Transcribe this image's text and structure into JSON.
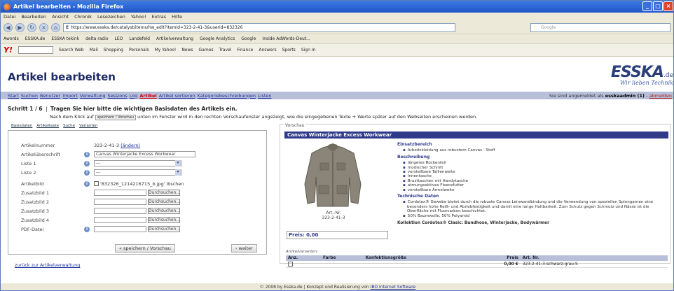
{
  "browser": {
    "title": "Artikel bearbeiten - Mozilla Firefox",
    "menu": [
      "Datei",
      "Bearbeiten",
      "Ansicht",
      "Chronik",
      "Lesezeichen",
      "Yahoo!",
      "Extras",
      "Hilfe"
    ],
    "url": "https://www.esska.de/catalyst/items/hw_edit?itemid=323-2-41-3&userid=832326",
    "search_placeholder": "Google",
    "bookmarks": [
      "Awords",
      "ESSKA.de",
      "ESSKA tekink",
      "delta radio",
      "LEO",
      "Landefeld",
      "Artikelverwaltung",
      "Google Analytics",
      "Google",
      "Inside AdWords-Deut..."
    ],
    "yahoo_items": [
      "Search Web",
      "Mail",
      "Shopping",
      "Personals",
      "My Yahoo!",
      "News",
      "Games",
      "Travel",
      "Finance",
      "Answers",
      "Sports",
      "Sign In"
    ]
  },
  "page": {
    "title": "Artikel bearbeiten",
    "brand": "ESSKA",
    "brand_suffix": ".de",
    "tagline": "Wir lieben Technik"
  },
  "nav": {
    "items": [
      "Start",
      "Suchen",
      "Benutzer",
      "Import",
      "Verwaltung",
      "Sessions",
      "Log",
      "Artikel",
      "Artikel sortieren",
      "Kategoriebeschreibungen",
      "Listen"
    ],
    "active": "Artikel",
    "user_prefix": "Sie sind angemeldet als",
    "user": "esskaadmin (1)",
    "logout": "abmelden"
  },
  "step": {
    "label": "Schritt 1 / 6",
    "headline": "Tragen Sie hier bitte die wichtigen Basisdaten des Artikels ein.",
    "line2_pre": "Nach dem Klick auf",
    "line2_btn": "speichern / Vorschau",
    "line2_post": "unten im Fenster wird in den rechten Vorschaufenster angezeigt, wie die eingegebenen Texte + Werte später auf den Webseiten erscheinen werden."
  },
  "tabs": [
    "Basisdaten",
    "Artikeltexte",
    "Suche",
    "Varianten"
  ],
  "form": {
    "artikelnummer_label": "Artikelnummer",
    "artikelnummer": "323-2-41-3",
    "aendern": "(ändern)",
    "ueberschrift_label": "Artikelüberschrift",
    "ueberschrift": "Canvas Winterjacke Excess Workwear",
    "liste1_label": "Liste 1",
    "liste2_label": "Liste 2",
    "select_value": "---",
    "bild_label": "Artikelbild",
    "bild_value": "'832326_1214216715_b.jpg' löschen",
    "zb1": "Zusatzbild 1",
    "zb2": "Zusatzbild 2",
    "zb3": "Zusatzbild 3",
    "zb4": "Zusatzbild 4",
    "pdf": "PDF-Datei",
    "browse": "Durchsuchen...",
    "save": "speichern / Vorschau",
    "next": "weiter"
  },
  "backlink": "zurück zur Artikelverwaltung",
  "preview": {
    "label": "Vorschau",
    "title": "Canvas Winterjacke Excess Workwear",
    "art_label": "Art.-Nr.",
    "art_nr": "323-2-41-3",
    "preis": "Preis: 0,00",
    "einsatz_h": "Einsatzbereich",
    "einsatz": [
      "Arbeitskleidung aus robustem Canvas - Stoff"
    ],
    "beschr_h": "Beschreibung",
    "beschr": [
      "längeres Rückenteil",
      "modischer Schnitt",
      "verstellbare Taillenweite",
      "Innentasche",
      "Brusttaschen mit Handytasche",
      "atmungsaktives Fleecefutter",
      "verstellbare Ärmelweite"
    ],
    "tech_h": "Technische Daten",
    "tech": [
      "Cordotex® Gewebe bietet durch die robuste Canvas Leinwandbindung und die Verwendung von speziellen Spinngarnen eine besonders hohe Reiß- und Abriebfestigkeit und damit eine lange Haltbarkeit. Zum Schutz gegen Schmutz und Nässe ist die Oberfläche mit Fluorcarbon beschichtet.",
      "50% Baumwolle, 50% Polyamid"
    ],
    "kollektion": "Kollektion Cordotex® Clasic: Bundhose, Winterjacke, Bodywärmer",
    "var_label": "Artikelvarianten:",
    "var_cols": [
      "Anz.",
      "Farbe",
      "Konfektionsgröße",
      "Preis",
      "Art. Nr."
    ],
    "var_price": "0,00 €",
    "var_art": "323-2-41-3-schwarz-grau-S"
  },
  "footer": {
    "text": "© 2008 by Esska.de | Konzept und Realisierung von",
    "link": "IBO Internet Software"
  }
}
